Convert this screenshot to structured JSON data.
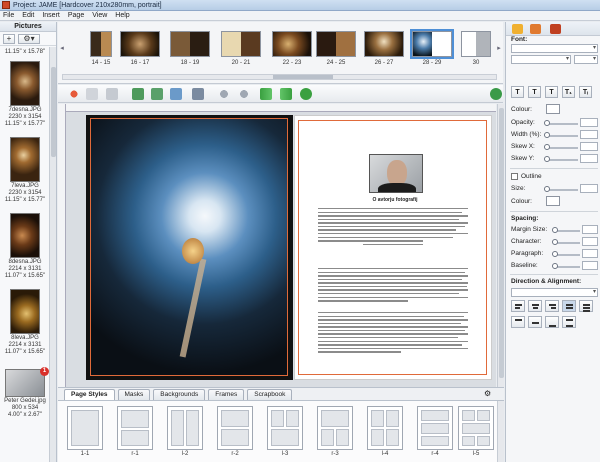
{
  "window": {
    "title": "Project: JAME  [Hardcover 210x280mm, portrait]"
  },
  "menu": [
    "File",
    "Edit",
    "Insert",
    "Page",
    "View",
    "Help"
  ],
  "pictures": {
    "header": "Pictures",
    "add_label": "+",
    "settings_label": "⚙▾",
    "items": [
      {
        "lines": [
          "11.15\" x 15.78\""
        ]
      },
      {
        "lines": [
          "7desna.JPG",
          "2230 x 3154",
          "11.15\" x 15.77\""
        ]
      },
      {
        "lines": [
          "7leva.JPG",
          "2230 x 3154",
          "11.15\" x 15.77\""
        ]
      },
      {
        "lines": [
          "8desna.JPG",
          "2214 x 3131",
          "11.07\" x 15.65\""
        ]
      },
      {
        "lines": [
          "8leva.JPG",
          "2214 x 3131",
          "11.07\" x 15.65\""
        ]
      },
      {
        "lines": [
          "Peter Gedei.jpg",
          "800 x 534",
          "4.00\" x 2.67\""
        ]
      }
    ],
    "badge": "1"
  },
  "spreads": [
    {
      "label": "14 - 15"
    },
    {
      "label": "16 - 17"
    },
    {
      "label": "18 - 19"
    },
    {
      "label": "20 - 21"
    },
    {
      "label": "22 - 23"
    },
    {
      "label": "24 - 25"
    },
    {
      "label": "26 - 27"
    },
    {
      "label": "28 - 29",
      "selected": true
    },
    {
      "label": "30"
    }
  ],
  "document": {
    "right_title": "O avtorju fotografij"
  },
  "bottom_tabs": [
    "Page Styles",
    "Masks",
    "Backgrounds",
    "Frames",
    "Scrapbook"
  ],
  "layouts": [
    "1-1",
    "r-1",
    "l-2",
    "r-2",
    "l-3",
    "r-3",
    "l-4",
    "r-4",
    "l-5"
  ],
  "properties": {
    "font_label": "Font:",
    "colour_label": "Colour:",
    "opacity_label": "Opacity:",
    "width_label": "Width (%):",
    "skewx_label": "Skew X:",
    "skewy_label": "Skew Y:",
    "outline_label": "Outline",
    "size_label": "Size:",
    "colour2_label": "Colour:",
    "spacing_label": "Spacing:",
    "margin_label": "Margin Size:",
    "character_label": "Character:",
    "paragraph_label": "Paragraph:",
    "baseline_label": "Baseline:",
    "direction_label": "Direction & Alignment:",
    "format_buttons": [
      "T",
      "T",
      "T",
      "T₁",
      "Tᵢ"
    ]
  },
  "colors": {
    "accent": "#4e8fd6",
    "bleed_line": "#e06a3a",
    "badge": "#d9302a"
  }
}
